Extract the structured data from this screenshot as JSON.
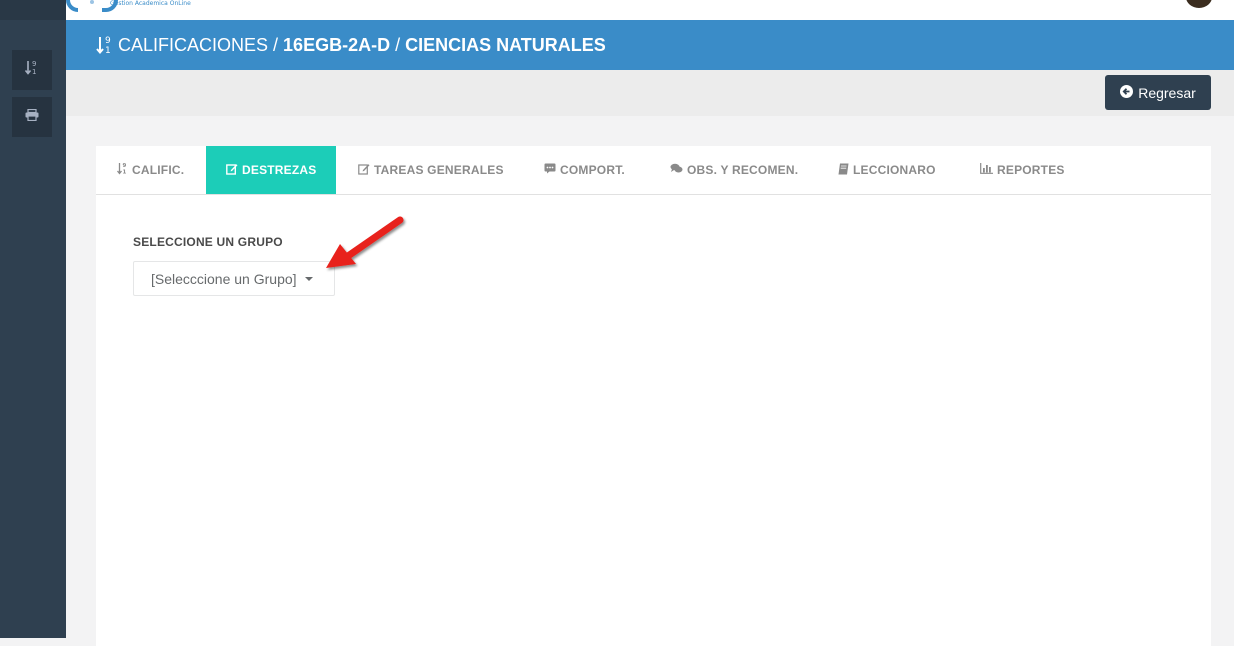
{
  "sidebar": {
    "buttons": [
      {
        "icon": "sort-numeric-icon"
      },
      {
        "icon": "print-icon"
      }
    ]
  },
  "topbar": {
    "logo_caption": "Gestion Academica OnLine"
  },
  "header": {
    "icon": "sort-numeric-icon",
    "section": "CALIFICACIONES",
    "separator": "/",
    "course": "16EGB-2A-D",
    "subject": "CIENCIAS NATURALES"
  },
  "toolbar": {
    "back_label": "Regresar",
    "back_icon": "arrow-circle-left-icon"
  },
  "tabs": [
    {
      "label": "CALIFIC.",
      "icon": "sort-numeric-icon",
      "active": false
    },
    {
      "label": "DESTREZAS",
      "icon": "edit-icon",
      "active": true
    },
    {
      "label": "TAREAS GENERALES",
      "icon": "edit-icon",
      "active": false
    },
    {
      "label": "COMPORT.",
      "icon": "comment-icon",
      "active": false
    },
    {
      "label": "OBS. Y RECOMEN.",
      "icon": "comments-icon",
      "active": false
    },
    {
      "label": "LECCIONARO",
      "icon": "book-icon",
      "active": false
    },
    {
      "label": "REPORTES",
      "icon": "bar-chart-icon",
      "active": false
    }
  ],
  "group_select": {
    "label": "SELECCIONE UN GRUPO",
    "value": "[Selecccione un Grupo]"
  },
  "colors": {
    "header_blue": "#3a8cc8",
    "sidebar_dark": "#2f4050",
    "tab_active": "#1ccdb8",
    "annotation_arrow": "#e8201c"
  }
}
